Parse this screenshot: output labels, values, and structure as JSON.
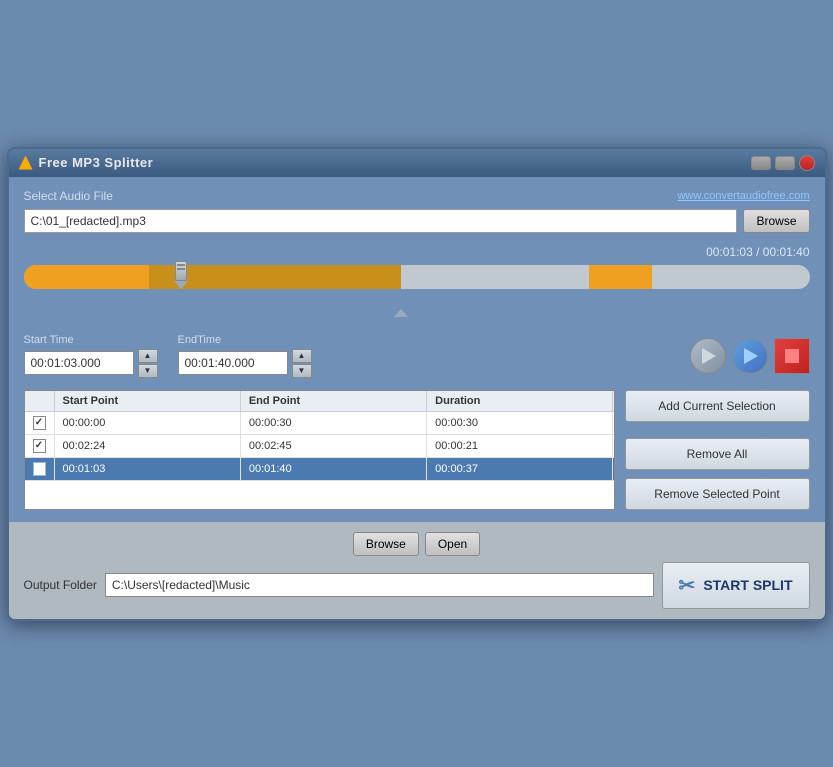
{
  "window": {
    "title": "Free MP3 Splitter"
  },
  "header": {
    "select_label": "Select Audio File",
    "website_link": "www.convertaudiofree.com",
    "file_path": "C:\\01_[redacted].mp3"
  },
  "timeline": {
    "current_time": "00:01:03 / 00:01:40"
  },
  "start_time": {
    "label": "Start Time",
    "value": "00:01:03.000"
  },
  "end_time": {
    "label": "EndTime",
    "value": "00:01:40.000"
  },
  "table": {
    "columns": [
      "",
      "Start Point",
      "End Point",
      "Duration"
    ],
    "rows": [
      {
        "checked": true,
        "start": "00:00:00",
        "end": "00:00:30",
        "duration": "00:00:30",
        "selected": false
      },
      {
        "checked": true,
        "start": "00:02:24",
        "end": "00:02:45",
        "duration": "00:00:21",
        "selected": false
      },
      {
        "checked": true,
        "start": "00:01:03",
        "end": "00:01:40",
        "duration": "00:00:37",
        "selected": true
      }
    ]
  },
  "buttons": {
    "browse": "Browse",
    "add_selection": "Add Current Selection",
    "remove_all": "Remove All",
    "remove_selected": "Remove Selected Point",
    "browse_output": "Browse",
    "open": "Open",
    "start_split": "START SPLIT"
  },
  "output": {
    "label": "Output Folder",
    "path": "C:\\Users\\[redacted]\\Music"
  }
}
